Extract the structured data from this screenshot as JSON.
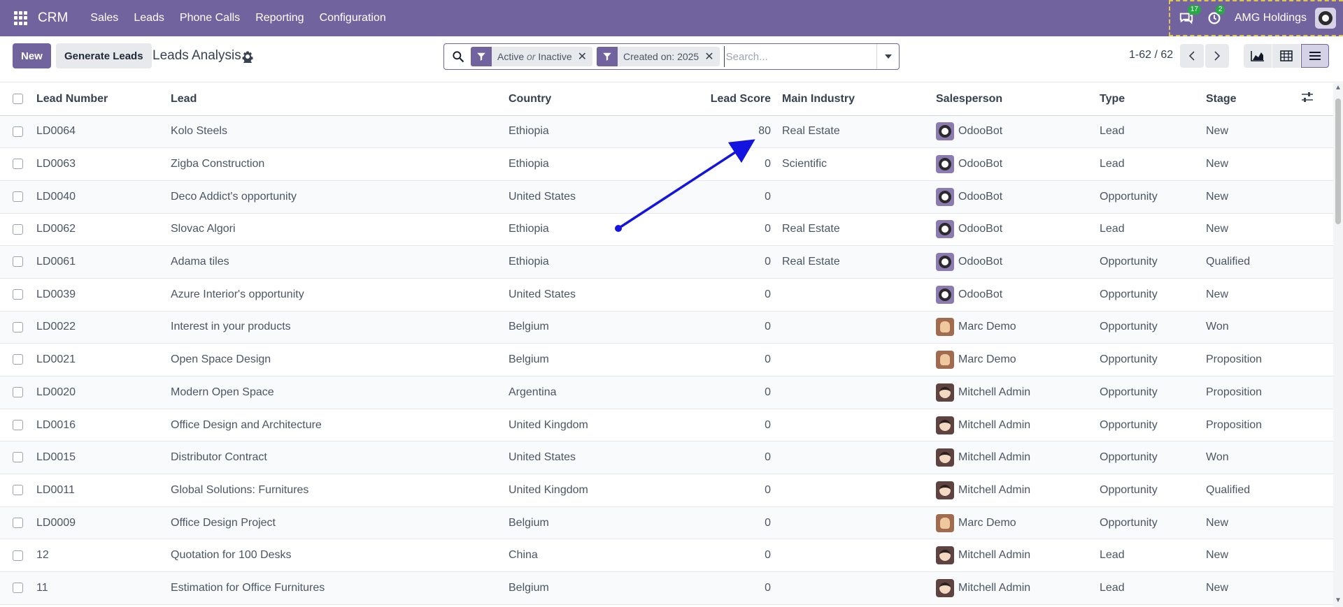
{
  "navbar": {
    "brand": "CRM",
    "menu": [
      "Sales",
      "Leads",
      "Phone Calls",
      "Reporting",
      "Configuration"
    ],
    "messages_count": "17",
    "activities_count": "2",
    "company": "AMG Holdings"
  },
  "control_panel": {
    "new_label": "New",
    "generate_label": "Generate Leads",
    "title": "Leads Analysis",
    "facets": [
      {
        "part1": "Active",
        "sep": "or",
        "part2": "Inactive"
      },
      {
        "part1": "Created on: 2025",
        "sep": "",
        "part2": ""
      }
    ],
    "search_placeholder": "Search...",
    "pager": "1-62 / 62"
  },
  "table": {
    "columns": [
      "Lead Number",
      "Lead",
      "Country",
      "Lead Score",
      "Main Industry",
      "Salesperson",
      "Type",
      "Stage"
    ],
    "rows": [
      {
        "number": "LD0064",
        "lead": "Kolo Steels",
        "country": "Ethiopia",
        "score": "80",
        "industry": "Real Estate",
        "salesperson": "OdooBot",
        "avatar": "bot",
        "type": "Lead",
        "stage": "New"
      },
      {
        "number": "LD0063",
        "lead": "Zigba Construction",
        "country": "Ethiopia",
        "score": "0",
        "industry": "Scientific",
        "salesperson": "OdooBot",
        "avatar": "bot",
        "type": "Lead",
        "stage": "New"
      },
      {
        "number": "LD0040",
        "lead": "Deco Addict's opportunity",
        "country": "United States",
        "score": "0",
        "industry": "",
        "salesperson": "OdooBot",
        "avatar": "bot",
        "type": "Opportunity",
        "stage": "New"
      },
      {
        "number": "LD0062",
        "lead": "Slovac Algori",
        "country": "Ethiopia",
        "score": "0",
        "industry": "Real Estate",
        "salesperson": "OdooBot",
        "avatar": "bot",
        "type": "Lead",
        "stage": "New"
      },
      {
        "number": "LD0061",
        "lead": "Adama tiles",
        "country": "Ethiopia",
        "score": "0",
        "industry": "Real Estate",
        "salesperson": "OdooBot",
        "avatar": "bot",
        "type": "Opportunity",
        "stage": "Qualified"
      },
      {
        "number": "LD0039",
        "lead": "Azure Interior's opportunity",
        "country": "United States",
        "score": "0",
        "industry": "",
        "salesperson": "OdooBot",
        "avatar": "bot",
        "type": "Opportunity",
        "stage": "New"
      },
      {
        "number": "LD0022",
        "lead": "Interest in your products",
        "country": "Belgium",
        "score": "0",
        "industry": "",
        "salesperson": "Marc Demo",
        "avatar": "marc",
        "type": "Opportunity",
        "stage": "Won"
      },
      {
        "number": "LD0021",
        "lead": "Open Space Design",
        "country": "Belgium",
        "score": "0",
        "industry": "",
        "salesperson": "Marc Demo",
        "avatar": "marc",
        "type": "Opportunity",
        "stage": "Proposition"
      },
      {
        "number": "LD0020",
        "lead": "Modern Open Space",
        "country": "Argentina",
        "score": "0",
        "industry": "",
        "salesperson": "Mitchell Admin",
        "avatar": "mitch",
        "type": "Opportunity",
        "stage": "Proposition"
      },
      {
        "number": "LD0016",
        "lead": "Office Design and Architecture",
        "country": "United Kingdom",
        "score": "0",
        "industry": "",
        "salesperson": "Mitchell Admin",
        "avatar": "mitch",
        "type": "Opportunity",
        "stage": "Proposition"
      },
      {
        "number": "LD0015",
        "lead": "Distributor Contract",
        "country": "United States",
        "score": "0",
        "industry": "",
        "salesperson": "Mitchell Admin",
        "avatar": "mitch",
        "type": "Opportunity",
        "stage": "Won"
      },
      {
        "number": "LD0011",
        "lead": "Global Solutions: Furnitures",
        "country": "United Kingdom",
        "score": "0",
        "industry": "",
        "salesperson": "Mitchell Admin",
        "avatar": "mitch",
        "type": "Opportunity",
        "stage": "Qualified"
      },
      {
        "number": "LD0009",
        "lead": "Office Design Project",
        "country": "Belgium",
        "score": "0",
        "industry": "",
        "salesperson": "Marc Demo",
        "avatar": "marc",
        "type": "Opportunity",
        "stage": "New"
      },
      {
        "number": "12",
        "lead": "Quotation for 100 Desks",
        "country": "China",
        "score": "0",
        "industry": "",
        "salesperson": "Mitchell Admin",
        "avatar": "mitch",
        "type": "Lead",
        "stage": "New"
      },
      {
        "number": "11",
        "lead": "Estimation for Office Furnitures",
        "country": "Belgium",
        "score": "0",
        "industry": "",
        "salesperson": "Mitchell Admin",
        "avatar": "mitch",
        "type": "Lead",
        "stage": "New"
      }
    ]
  },
  "colors": {
    "brand": "#71639e",
    "annotation_arrow": "#1414e0"
  }
}
